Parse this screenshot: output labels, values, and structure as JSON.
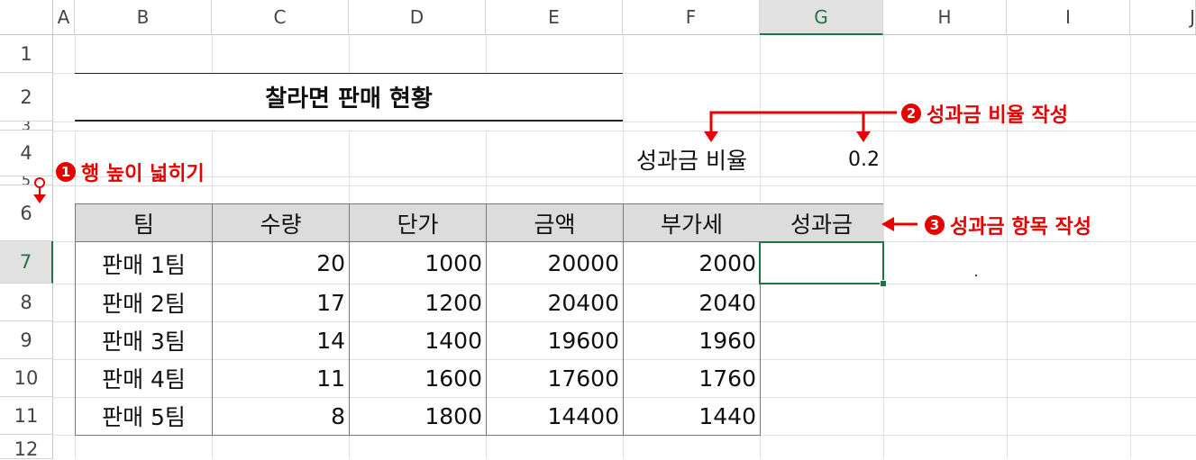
{
  "columns": [
    "A",
    "B",
    "C",
    "D",
    "E",
    "F",
    "G",
    "H",
    "I",
    "J"
  ],
  "rows": [
    "1",
    "2",
    "3",
    "4",
    "5",
    "6",
    "7",
    "8",
    "9",
    "10",
    "11",
    "12"
  ],
  "title": "찰라면 판매 현황",
  "rate_label": "성과금 비율",
  "rate_value": "0.2",
  "table_headers": [
    "팀",
    "수량",
    "단가",
    "금액",
    "부가세",
    "성과금"
  ],
  "table_rows": [
    {
      "team": "판매 1팀",
      "qty": "20",
      "price": "1000",
      "amount": "20000",
      "vat": "2000"
    },
    {
      "team": "판매 2팀",
      "qty": "17",
      "price": "1200",
      "amount": "20400",
      "vat": "2040"
    },
    {
      "team": "판매 3팀",
      "qty": "14",
      "price": "1400",
      "amount": "19600",
      "vat": "1960"
    },
    {
      "team": "판매 4팀",
      "qty": "11",
      "price": "1600",
      "amount": "17600",
      "vat": "1760"
    },
    {
      "team": "판매 5팀",
      "qty": "8",
      "price": "1800",
      "amount": "14400",
      "vat": "1440"
    }
  ],
  "annotations": {
    "a1": {
      "num": "1",
      "text": "행 높이 넓히기"
    },
    "a2": {
      "num": "2",
      "text": "성과금 비율 작성"
    },
    "a3": {
      "num": "3",
      "text": "성과금 항목 작성"
    }
  },
  "colors": {
    "annotation": "#e60000",
    "selection": "#217346",
    "header_fill": "#dcdcdc"
  }
}
